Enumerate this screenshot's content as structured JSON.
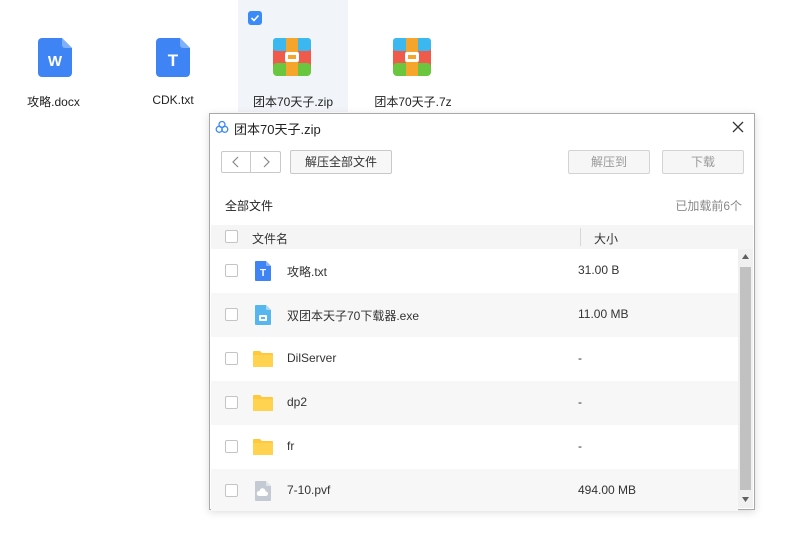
{
  "desktop": {
    "icons": [
      {
        "label": "攻略.docx",
        "type": "docx",
        "selected": false
      },
      {
        "label": "CDK.txt",
        "type": "txt",
        "selected": false
      },
      {
        "label": "团本70天子.zip",
        "type": "archive",
        "selected": true
      },
      {
        "label": "团本70天子.7z",
        "type": "archive",
        "selected": false
      }
    ]
  },
  "dialog": {
    "title": "团本70天子.zip",
    "toolbar": {
      "extract_all": "解压全部文件",
      "extract_to": "解压到",
      "download": "下载"
    },
    "section_title": "全部文件",
    "loaded_count": "已加载前6个",
    "columns": {
      "name": "文件名",
      "size": "大小"
    },
    "files": [
      {
        "name": "攻略.txt",
        "size": "31.00 B",
        "icon": "txt-file-icon"
      },
      {
        "name": "双团本天子70下载器.exe",
        "size": "11.00 MB",
        "icon": "exe-file-icon"
      },
      {
        "name": "DilServer",
        "size": "-",
        "icon": "folder-icon"
      },
      {
        "name": "dp2",
        "size": "-",
        "icon": "folder-icon"
      },
      {
        "name": "fr",
        "size": "-",
        "icon": "folder-icon"
      },
      {
        "name": "7-10.pvf",
        "size": "494.00 MB",
        "icon": "unknown-file-icon"
      }
    ]
  },
  "colors": {
    "accent": "#3a8af7",
    "folder": "#ffc83d",
    "txt_icon": "#3f84f5",
    "exe_icon": "#57b6ee"
  }
}
